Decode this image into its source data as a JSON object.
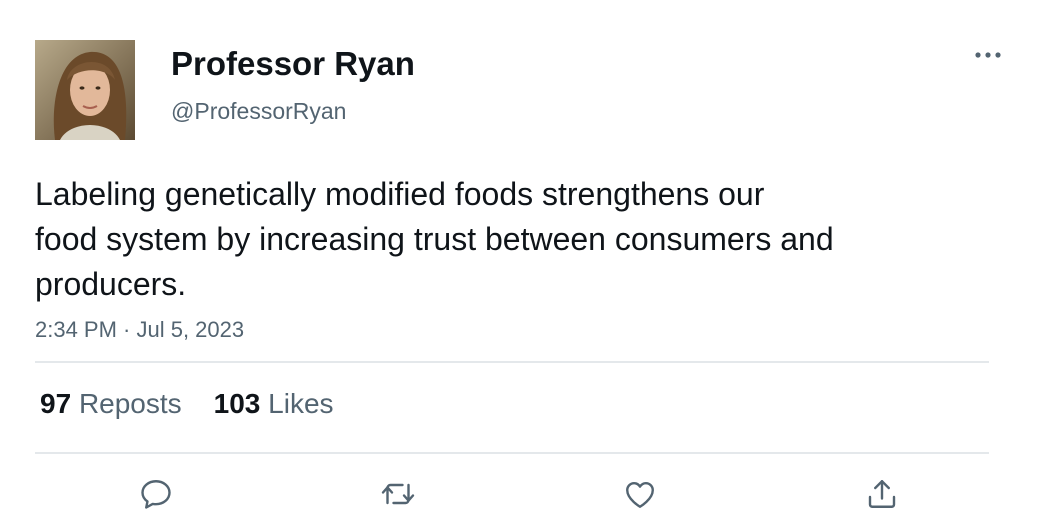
{
  "author": {
    "display_name": "Professor Ryan",
    "handle": "@ProfessorRyan",
    "avatar_icon": "user-avatar-photo"
  },
  "more_icon": "more-options-icon",
  "tweet": {
    "text_lines": [
      "Labeling genetically modified foods strengthens our",
      "food system by increasing trust between consumers and",
      "producers."
    ],
    "timestamp": "2:34 PM · Jul 5, 2023"
  },
  "stats": {
    "reposts_count": "97",
    "reposts_label": "Reposts",
    "likes_count": "103",
    "likes_label": "Likes"
  },
  "actions": [
    {
      "name": "reply",
      "icon": "reply-icon"
    },
    {
      "name": "repost",
      "icon": "repost-icon"
    },
    {
      "name": "like",
      "icon": "heart-icon"
    },
    {
      "name": "share",
      "icon": "share-icon"
    }
  ],
  "colors": {
    "text_primary": "#0f1419",
    "text_secondary": "#536471",
    "divider": "#e4e8eb",
    "icon": "#536471"
  }
}
